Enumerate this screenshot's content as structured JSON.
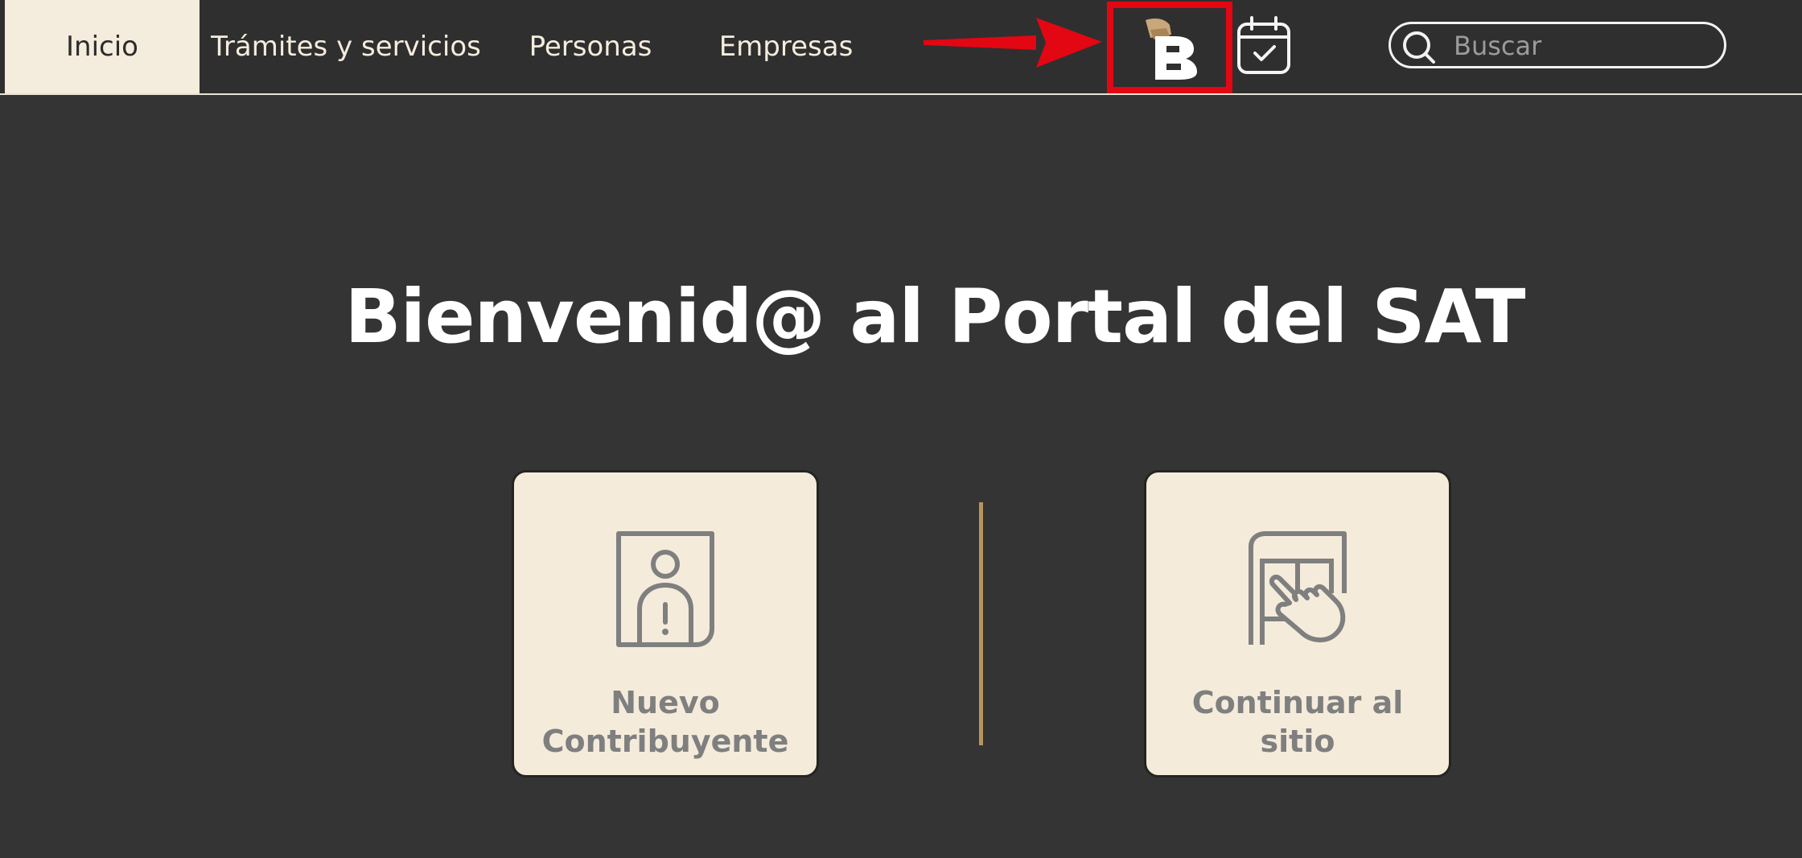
{
  "colors": {
    "background": "#343434",
    "nav_background": "#2f2f2f",
    "active_tab": "#f4ecdc",
    "card_background": "#f4ebdb",
    "accent_gold": "#b8955e",
    "annotation_red": "#e30613"
  },
  "nav": {
    "items": [
      {
        "label": "Inicio",
        "active": true
      },
      {
        "label": "Trámites y servicios",
        "active": false
      },
      {
        "label": "Personas",
        "active": false
      },
      {
        "label": "Empresas",
        "active": false
      }
    ]
  },
  "icons": {
    "brand": "brand-b-logo-icon",
    "calendar": "calendar-check-icon",
    "search": "search-icon",
    "new_taxpayer": "id-card-person-alert-icon",
    "continue": "touch-screen-hand-icon",
    "annotation": "red-arrow-icon"
  },
  "search": {
    "placeholder": "Buscar"
  },
  "hero": {
    "title": "Bienvenid@ al Portal del SAT"
  },
  "cards": [
    {
      "label_line1": "Nuevo",
      "label_line2": "Contribuyente"
    },
    {
      "label_line1": "Continuar al",
      "label_line2": "sitio"
    }
  ]
}
